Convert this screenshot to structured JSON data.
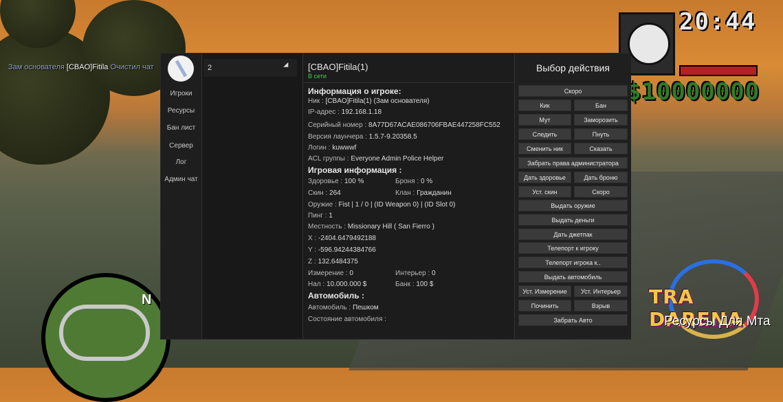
{
  "chat": {
    "prefix": "Зам основателя",
    "nick": "[CBAO]Fitila",
    "message": "Очистил чат"
  },
  "hud": {
    "time": "20:44",
    "money": "$10000000"
  },
  "minimap": {
    "north": "N"
  },
  "logo": {
    "line1": "TRA DARENA",
    "line2": "Ресурсы Для Мта"
  },
  "nav": {
    "items": [
      "Игроки",
      "Ресурсы",
      "Бан лист",
      "Сервер",
      "Лог",
      "Админ чат"
    ]
  },
  "list": {
    "search_value": "2"
  },
  "player": {
    "name": "[CBAO]Fitila(1)",
    "status": "В сети"
  },
  "info": {
    "section_player": "Информация о игроке:",
    "nick": {
      "k": "Ник :",
      "v": "[CBAO]Fitila(1) (Зам основателя)"
    },
    "ip": {
      "k": "IP-адрес :",
      "v": "192.168.1.18"
    },
    "serial": {
      "k": "Серийный номер :",
      "v": "8A77D67ACAE086706FBAE447258FC552"
    },
    "launcher": {
      "k": "Версия лаунчера :",
      "v": "1.5.7-9.20358.5"
    },
    "login": {
      "k": "Логин :",
      "v": "kuwwwf"
    },
    "acl": {
      "k": "ACL группы :",
      "v": "Everyone Admin Police Helper"
    },
    "section_game": "Игровая информация :",
    "health": {
      "k": "Здоровье :",
      "v": "100 %"
    },
    "armor": {
      "k": "Броня :",
      "v": "0 %"
    },
    "skin": {
      "k": "Скин :",
      "v": "264"
    },
    "clan": {
      "k": "Клан :",
      "v": "Гражданин"
    },
    "weapon": {
      "k": "Оружие :",
      "v": "Fist | 1 / 0 | (ID Weapon 0) | (ID Slot 0)"
    },
    "ping": {
      "k": "Пинг :",
      "v": "1"
    },
    "location": {
      "k": "Местность :",
      "v": "Missionary Hill ( San Fierro )"
    },
    "x": {
      "k": "X :",
      "v": "-2404.6479492188"
    },
    "y": {
      "k": "Y :",
      "v": "-596.94244384766"
    },
    "z": {
      "k": "Z :",
      "v": "132.6484375"
    },
    "dimension": {
      "k": "Измерение :",
      "v": "0"
    },
    "interior": {
      "k": "Интерьер :",
      "v": "0"
    },
    "cash": {
      "k": "Нал :",
      "v": "10.000.000 $"
    },
    "bank": {
      "k": "Банк :",
      "v": "100 $"
    },
    "section_vehicle": "Автомобиль :",
    "vehicle": {
      "k": "Автомобиль :",
      "v": "Пешком"
    },
    "vehicle_state": {
      "k": "Состояние автомобиля :",
      "v": ""
    }
  },
  "actions": {
    "title": "Выбор действия",
    "buttons": {
      "skoro1": "Скоро",
      "kick": "Кик",
      "ban": "Бан",
      "mute": "Мут",
      "freeze": "Заморозить",
      "spectate": "Следить",
      "slap": "Пнуть",
      "change_nick": "Сменить ник",
      "say": "Сказать",
      "take_admin": "Забрать права администратора",
      "give_health": "Дать здоровье",
      "give_armor": "Дать броню",
      "set_skin": "Уст. скин",
      "skoro2": "Скоро",
      "give_weapon": "Выдать оружие",
      "give_money": "Выдать деньги",
      "give_jetpack": "Дать джетпак",
      "tp_to_player": "Телепорт к игроку",
      "tp_player_to": "Телепорт игрока к..",
      "give_vehicle": "Выдать автомобиль",
      "set_dimension": "Уст. Измерение",
      "set_interior": "Уст. Интерьер",
      "repair": "Починить",
      "explode": "Взрыв",
      "take_vehicle": "Забрать Авто"
    }
  }
}
